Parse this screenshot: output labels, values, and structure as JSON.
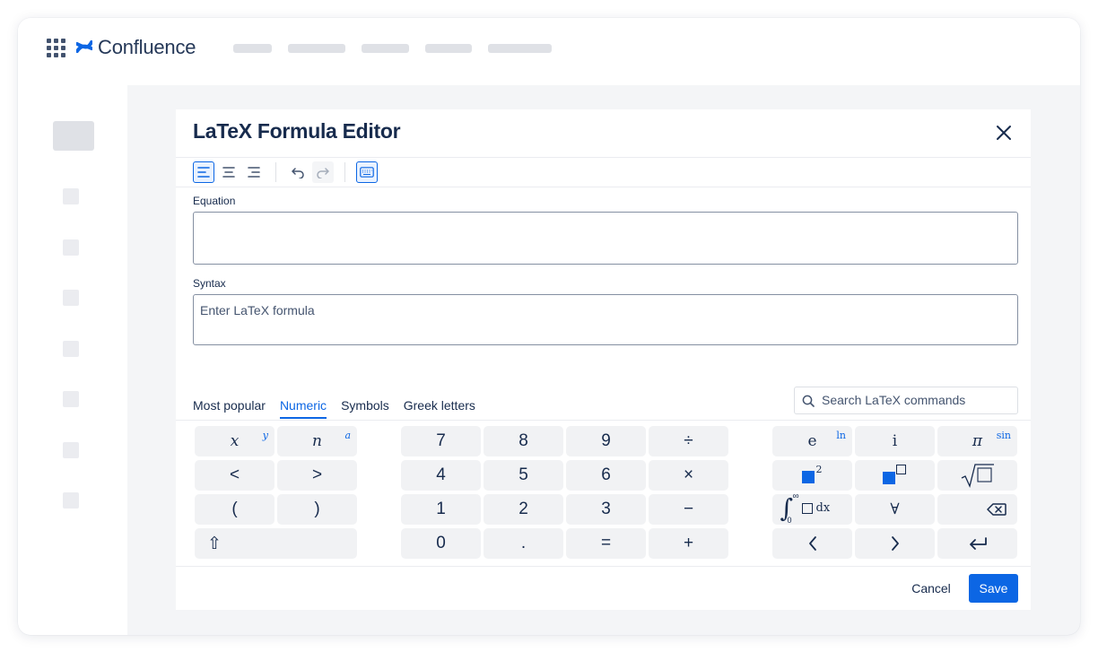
{
  "app": {
    "name": "Confluence",
    "icon": "confluence-logo",
    "apps_icon": "apps-grid-icon"
  },
  "dialog": {
    "title": "LaTeX Formula Editor",
    "toolbar": [
      "align-left-icon",
      "align-center-icon",
      "align-right-icon",
      "undo-icon",
      "redo-icon",
      "keyboard-icon"
    ],
    "equation_label": "Equation",
    "syntax_label": "Syntax",
    "syntax_placeholder": "Enter LaTeX formula",
    "syntax_value": "",
    "tabs": [
      "Most popular",
      "Numeric",
      "Symbols",
      "Greek letters"
    ],
    "active_tab": "Numeric",
    "search_placeholder": "Search LaTeX commands",
    "cancel_label": "Cancel",
    "save_label": "Save"
  },
  "keypad": {
    "left": [
      {
        "label": "x",
        "sup": "y"
      },
      {
        "label": "n",
        "sup": "a"
      },
      {
        "label": "<"
      },
      {
        "label": ">"
      },
      {
        "label": "("
      },
      {
        "label": ")"
      },
      {
        "label": "⇧",
        "icon": "shift-icon"
      }
    ],
    "middle": [
      "7",
      "8",
      "9",
      "÷",
      "4",
      "5",
      "6",
      "×",
      "1",
      "2",
      "3",
      "−",
      "0",
      ".",
      "=",
      "+"
    ],
    "right": [
      {
        "label": "e",
        "sup": "ln"
      },
      {
        "label": "i"
      },
      {
        "label": "π",
        "sup": "sin"
      },
      {
        "label": "",
        "sup": "2",
        "icon": "square-power-icon"
      },
      {
        "label": "",
        "icon": "square-superscript-box-icon"
      },
      {
        "label": "",
        "icon": "square-root-icon"
      },
      {
        "label": "dx",
        "icon": "integral-icon",
        "sup": "∞",
        "sub": "0"
      },
      {
        "label": "∀"
      },
      {
        "label": "",
        "icon": "backspace-icon"
      },
      {
        "label": "",
        "icon": "arrow-left-icon"
      },
      {
        "label": "",
        "icon": "arrow-right-icon"
      },
      {
        "label": "",
        "icon": "enter-icon"
      }
    ]
  },
  "colors": {
    "brand": "#0c66e4",
    "key_bg": "#f1f2f4",
    "text": "#172b4d",
    "accent_square": "#0c66e4"
  }
}
